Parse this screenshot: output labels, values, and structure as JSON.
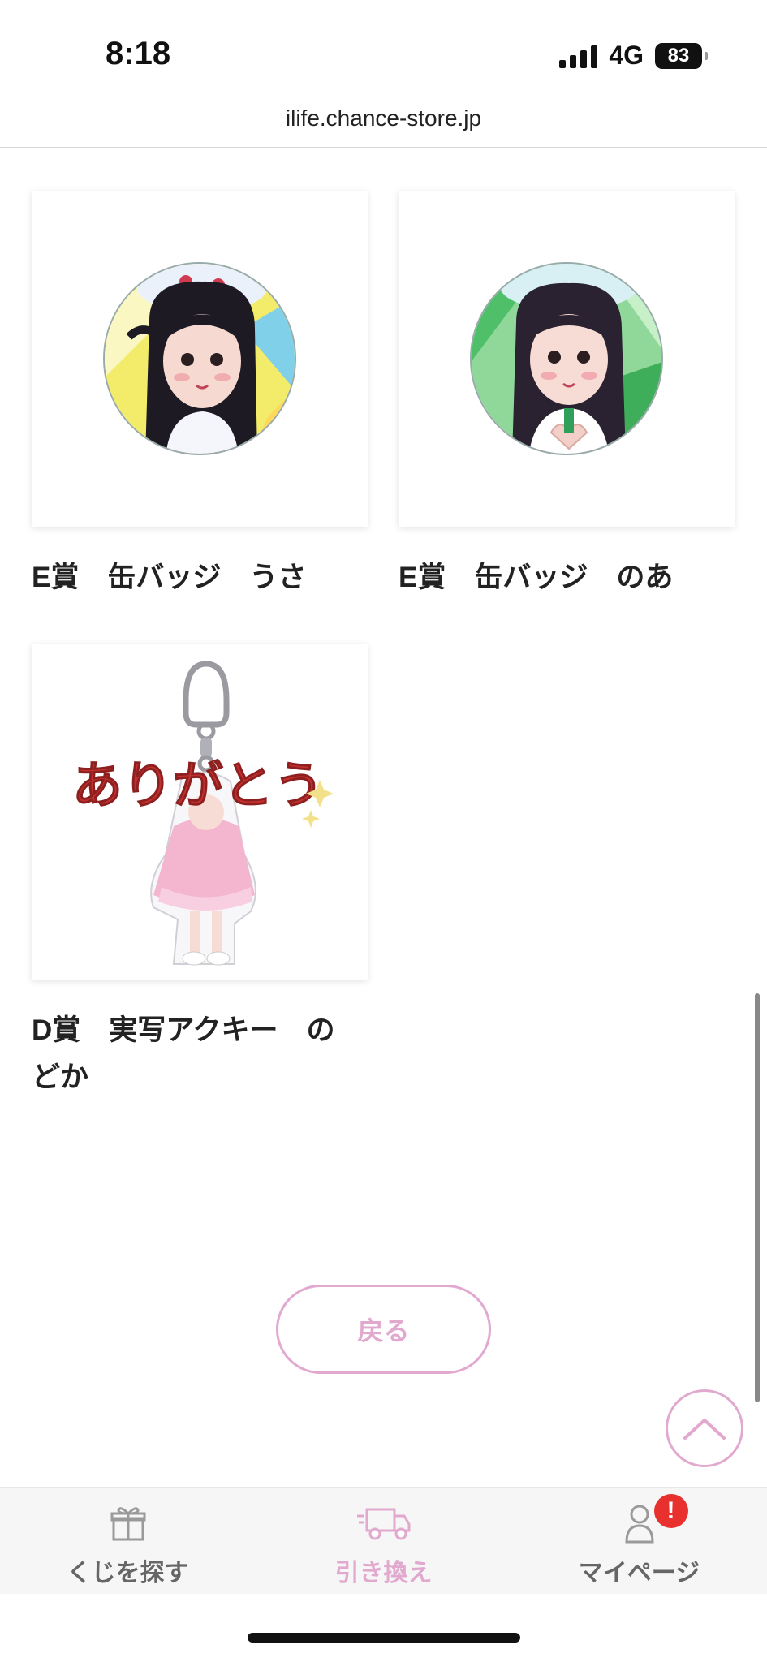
{
  "status_bar": {
    "time": "8:18",
    "network": "4G",
    "battery": "83"
  },
  "browser": {
    "url": "ilife.chance-store.jp"
  },
  "products": [
    {
      "title": "E賞　缶バッジ　うさ"
    },
    {
      "title": "E賞　缶バッジ　のあ"
    },
    {
      "title": "D賞　実写アクキー　の\nどか",
      "image_text": "ありがとう"
    }
  ],
  "back_button": {
    "label": "戻る"
  },
  "bottom_nav": {
    "items": [
      {
        "label": "くじを探す",
        "icon": "gift-icon"
      },
      {
        "label": "引き換え",
        "icon": "truck-icon"
      },
      {
        "label": "マイページ",
        "icon": "user-icon",
        "badge": "!"
      }
    ]
  },
  "colors": {
    "accent": "#e2a9cf",
    "alert": "#e8312f"
  }
}
